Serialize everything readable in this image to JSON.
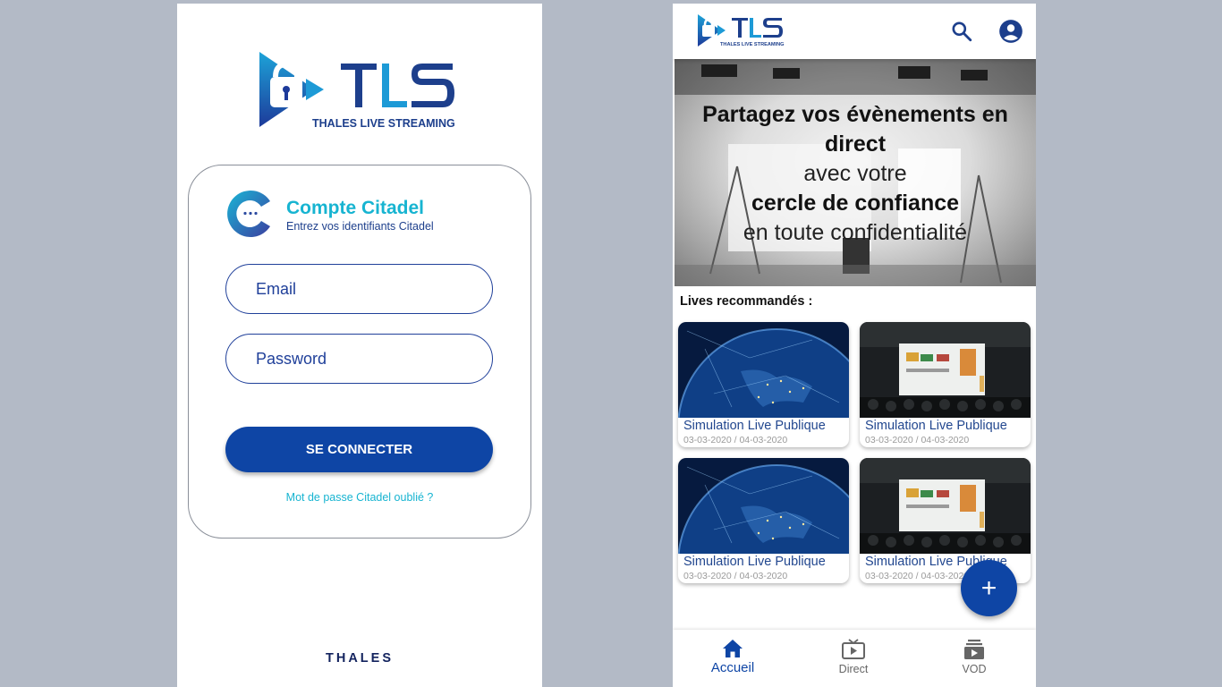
{
  "login": {
    "logo": {
      "text": "TLS",
      "subtitle": "THALES LIVE STREAMING"
    },
    "card": {
      "title": "Compte Citadel",
      "subtitle": "Entrez vos identifiants Citadel",
      "email_placeholder": "Email",
      "password_placeholder": "Password",
      "connect_label": "SE CONNECTER",
      "forgot_label": "Mot de passe Citadel oublié ?"
    },
    "footer_brand": "THALES"
  },
  "home": {
    "header": {
      "logo_text": "TLS",
      "logo_subtitle": "THALES LIVE STREAMING",
      "search_icon": "search-icon",
      "account_icon": "account-icon"
    },
    "hero": {
      "line1": "Partagez vos évènements en",
      "line2": "direct",
      "line3": "avec votre",
      "line4": "cercle de confiance",
      "line5": "en toute confidentialité"
    },
    "section_title": "Lives recommandés :",
    "cards": [
      {
        "title": "Simulation Live Publique",
        "date": "03-03-2020 / 04-03-2020",
        "thumb": "earth"
      },
      {
        "title": "Simulation Live Publique",
        "date": "03-03-2020 / 04-03-2020",
        "thumb": "conference"
      },
      {
        "title": "Simulation Live Publique",
        "date": "03-03-2020 / 04-03-2020",
        "thumb": "earth"
      },
      {
        "title": "Simulation Live Publique",
        "date": "03-03-2020 / 04-03-2020",
        "thumb": "conference"
      }
    ],
    "fab_label": "+",
    "nav": [
      {
        "label": "Accueil",
        "icon": "home-icon",
        "active": true
      },
      {
        "label": "Direct",
        "icon": "tv-play-icon",
        "active": false
      },
      {
        "label": "VOD",
        "icon": "video-library-icon",
        "active": false
      }
    ]
  },
  "colors": {
    "primary": "#0e45a5",
    "accent": "#17b4d1",
    "background": "#b3bac6",
    "text_blue": "#22478f"
  }
}
